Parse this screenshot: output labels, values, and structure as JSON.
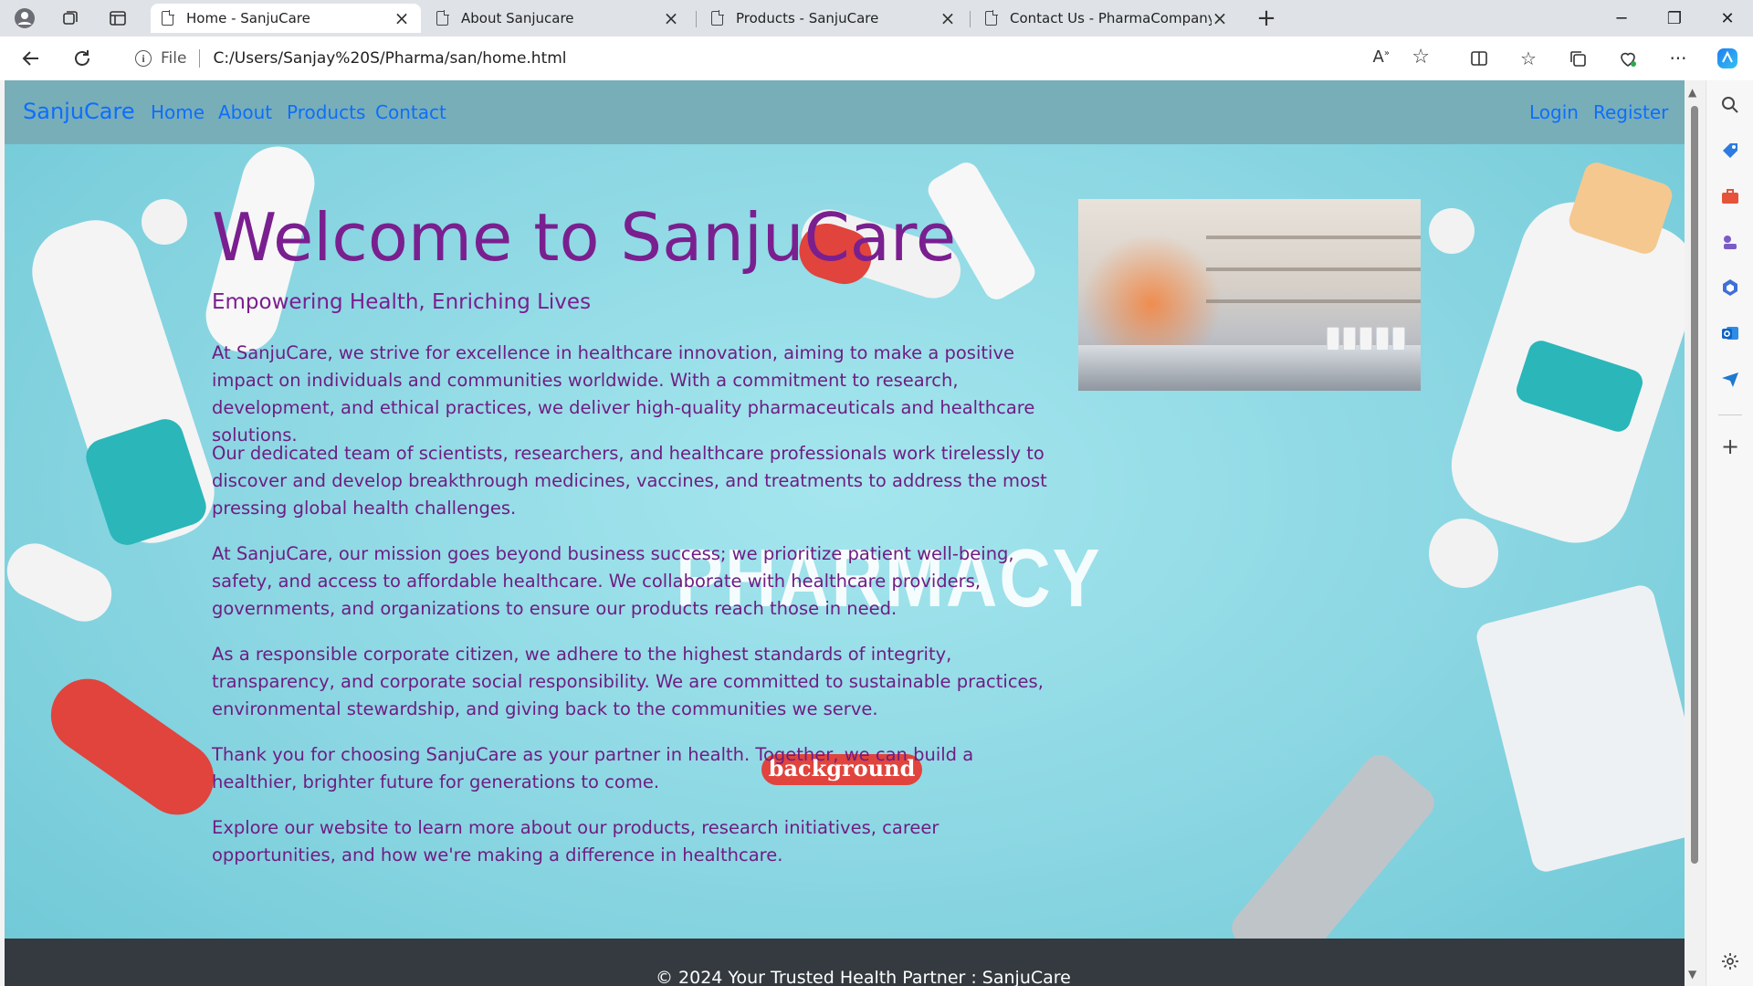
{
  "browser": {
    "tabs": [
      {
        "title": "Home - SanjuCare",
        "active": true
      },
      {
        "title": "About Sanjucare",
        "active": false
      },
      {
        "title": "Products - SanjuCare",
        "active": false
      },
      {
        "title": "Contact Us - PharmaCompany",
        "active": false
      }
    ],
    "address": {
      "scheme_label": "File",
      "url": "C:/Users/Sanjay%20S/Pharma/san/home.html"
    },
    "window_controls": {
      "minimize": "─",
      "restore": "❐",
      "close": "✕"
    },
    "new_tab": "+"
  },
  "page": {
    "brand": "SanjuCare",
    "nav": {
      "home": "Home",
      "about": "About",
      "products": "Products",
      "contact": "Contact",
      "login": "Login",
      "register": "Register"
    },
    "hero": {
      "title": "Welcome to SanjuCare",
      "subtitle": "Empowering Health, Enriching Lives"
    },
    "paragraphs": [
      "At SanjuCare, we strive for excellence in healthcare innovation, aiming to make a positive impact on individuals and communities worldwide. With a commitment to research, development, and ethical practices, we deliver high-quality pharmaceuticals and healthcare solutions.",
      "Our dedicated team of scientists, researchers, and healthcare professionals work tirelessly to discover and develop breakthrough medicines, vaccines, and treatments to address the most pressing global health challenges.",
      "At SanjuCare, our mission goes beyond business success; we prioritize patient well-being, safety, and access to affordable healthcare. We collaborate with healthcare providers, governments, and organizations to ensure our products reach those in need.",
      "As a responsible corporate citizen, we adhere to the highest standards of integrity, transparency, and corporate social responsibility. We are committed to sustainable practices, environmental stewardship, and giving back to the communities we serve.",
      "Thank you for choosing SanjuCare as your partner in health. Together, we can build a healthier, brighter future for generations to come.",
      "Explore our website to learn more about our products, research initiatives, career opportunities, and how we're making a difference in healthcare."
    ],
    "background_art": {
      "watermark_text": "PHARMACY",
      "pill_text": "background"
    },
    "footer": "© 2024 Your Trusted Health Partner : SanjuCare"
  },
  "colors": {
    "brand_link": "#0d6efd",
    "navbar_bg": "#78aeb8",
    "hero_text": "#7a1f8f",
    "footer_bg": "#343a40",
    "page_bg": "#8fdbe6"
  }
}
